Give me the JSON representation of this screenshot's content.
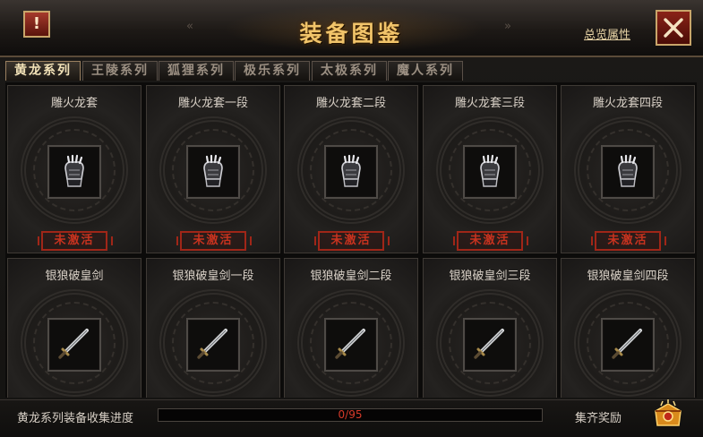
{
  "header": {
    "title": "装备图鉴",
    "overview_link": "总览属性",
    "alert_label": "!"
  },
  "tabs": [
    {
      "label": "黄龙系列",
      "active": true
    },
    {
      "label": "王陵系列",
      "active": false
    },
    {
      "label": "狐狸系列",
      "active": false
    },
    {
      "label": "极乐系列",
      "active": false
    },
    {
      "label": "太极系列",
      "active": false
    },
    {
      "label": "魔人系列",
      "active": false
    }
  ],
  "cards": [
    {
      "name": "雕火龙套",
      "icon": "gauntlet-icon",
      "status": "未激活"
    },
    {
      "name": "雕火龙套一段",
      "icon": "gauntlet-icon",
      "status": "未激活"
    },
    {
      "name": "雕火龙套二段",
      "icon": "gauntlet-icon",
      "status": "未激活"
    },
    {
      "name": "雕火龙套三段",
      "icon": "gauntlet-icon",
      "status": "未激活"
    },
    {
      "name": "雕火龙套四段",
      "icon": "gauntlet-icon",
      "status": "未激活"
    },
    {
      "name": "银狼破皇剑",
      "icon": "sword-icon",
      "status": ""
    },
    {
      "name": "银狼破皇剑一段",
      "icon": "sword-icon",
      "status": ""
    },
    {
      "name": "银狼破皇剑二段",
      "icon": "sword-icon",
      "status": ""
    },
    {
      "name": "银狼破皇剑三段",
      "icon": "sword-icon",
      "status": ""
    },
    {
      "name": "银狼破皇剑四段",
      "icon": "sword-icon",
      "status": ""
    }
  ],
  "footer": {
    "progress_label": "黄龙系列装备收集进度",
    "progress_text": "0/95",
    "progress_fraction": 0,
    "reward_label": "集齐奖励"
  },
  "colors": {
    "title_gold": "#f1c46a",
    "stamp_red": "#c8331f",
    "progress_text_red": "#d63a2a"
  }
}
